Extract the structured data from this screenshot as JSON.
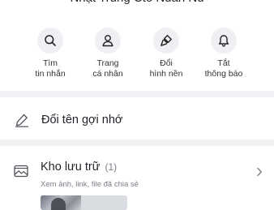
{
  "header": {
    "title": "Nhật Trung Cto Nuan Nu"
  },
  "actions": [
    {
      "line1": "Tìm",
      "line2": "tin nhắn",
      "icon": "search-icon"
    },
    {
      "line1": "Trang",
      "line2": "cá nhân",
      "icon": "user-icon"
    },
    {
      "line1": "Đổi",
      "line2": "hình nền",
      "icon": "brush-icon"
    },
    {
      "line1": "Tắt",
      "line2": "thông báo",
      "icon": "bell-icon"
    }
  ],
  "rename": {
    "label": "Đổi tên gợi nhớ",
    "icon": "pencil-icon"
  },
  "storage": {
    "title": "Kho lưu trữ",
    "count": "(1)",
    "subtitle": "Xem ảnh, link, file đã chia sẻ",
    "icon": "image-folder-icon"
  },
  "colors": {
    "icon_bg": "#eef0f3",
    "separator": "#f0f2f5",
    "text_primary": "#1f2328",
    "text_secondary": "#7b8088"
  }
}
